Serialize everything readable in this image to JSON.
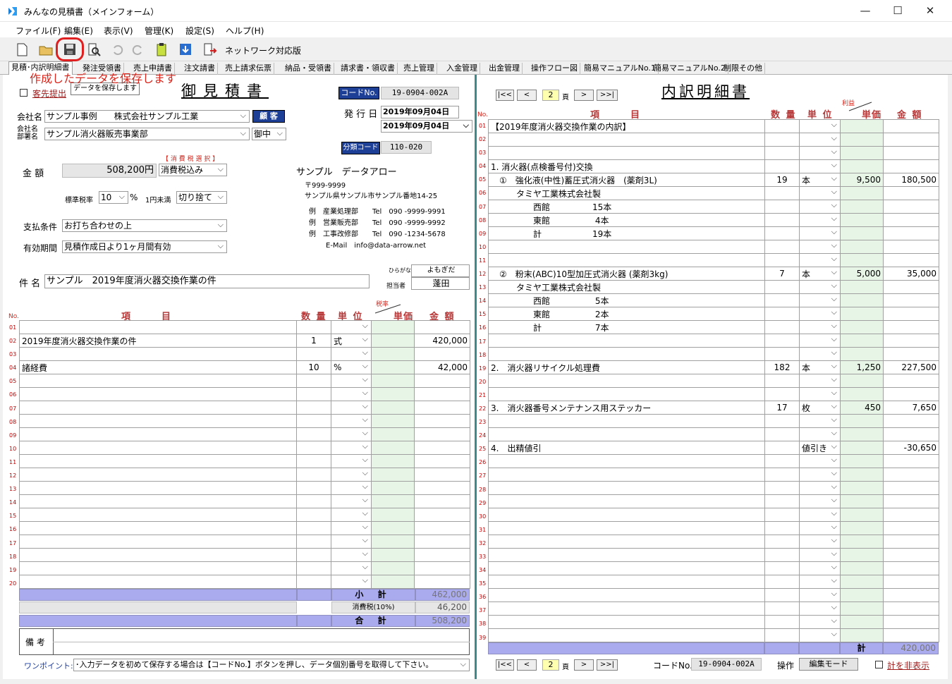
{
  "window": {
    "title": "みんなの見積書（メインフォーム）",
    "minimize": "—",
    "maximize": "☐",
    "close": "✕"
  },
  "menu": [
    "ファイル(F)",
    "編集(E)",
    "表示(V)",
    "管理(K)",
    "設定(S)",
    "ヘルプ(H)"
  ],
  "toolbar": {
    "network_label": "ネットワーク対応版",
    "save_tooltip": "データを保存します",
    "annotation": "作成したデータを保存します"
  },
  "tabs": [
    "見積･内訳明細書",
    "発注受領書",
    "売上申請書",
    "注文請書",
    "売上請求伝票",
    "納品・受領書",
    "請求書・領収書",
    "売上管理",
    "入金管理",
    "出金管理",
    "操作フロー図",
    "簡易マニュアルNo.1",
    "簡易マニュアルNo.2",
    "制限その他"
  ],
  "quote": {
    "title": "御見積書",
    "customer_submit_label": "客先提出",
    "code_label": "コードNo.",
    "code_value": "19-0904-002A",
    "issue_label": "発 行 日",
    "issue_date": "2019年09月04日",
    "issue_date2": "2019年09月04日",
    "class_label": "分類コード",
    "class_value": "110-020",
    "company_label": "会社名",
    "company_value": "サンプル事例　　株式会社サンプル工業",
    "customer_btn": "顧 客",
    "dept_label": "会社名\n部署名",
    "dept_value": "サンプル消火器販売事業部",
    "honorific": "御中",
    "amount_label": "金 額",
    "amount_value": "508,200円",
    "tax_select_label": "【 消 費 税 選 択 】",
    "tax_select_value": "消費税込み",
    "std_tax_label": "標準税率",
    "std_tax_value": "10",
    "percent": "%",
    "round_label": "1円未満",
    "round_value": "切り捨て",
    "payment_label": "支払条件",
    "payment_value": "お打ち合わせの上",
    "validity_label": "有効期間",
    "validity_value": "見積作成日より1ヶ月間有効",
    "subject_label": "件 名",
    "subject_value": "サンプル　2019年度消火器交換作業の件",
    "furigana_label": "ひらがな",
    "furigana_value": "よもぎだ",
    "person_label": "担当者",
    "person_value": "蓬田"
  },
  "sender": {
    "name": "サンプル　データアロー",
    "zip": "〒999-9999",
    "address": "サンプル県サンプル市サンプル番地14-25",
    "lines": [
      "例　産業処理部　　Tel　090 -9999-9991",
      "例　営業販売部　　Tel　090 -9999-9992",
      "例　工事改修部　　Tel　090 -1234-5678"
    ],
    "email": "E-Mail　info@data-arrow.net"
  },
  "left_table": {
    "headers": {
      "no": "No.",
      "item": "項　　目",
      "qty": "数 量",
      "unit": "単 位",
      "tax_rate": "税率",
      "price": "単価",
      "amount": "金 額"
    },
    "rows": [
      {
        "no": "01",
        "item": "",
        "qty": "",
        "unit": "",
        "price": "",
        "amount": ""
      },
      {
        "no": "02",
        "item": "2019年度消火器交換作業の件",
        "qty": "1",
        "unit": "式",
        "price": "",
        "amount": "420,000"
      },
      {
        "no": "03",
        "item": "",
        "qty": "",
        "unit": "",
        "price": "",
        "amount": ""
      },
      {
        "no": "04",
        "item": "諸経費",
        "qty": "10",
        "unit": "%",
        "price": "",
        "amount": "42,000"
      },
      {
        "no": "05",
        "item": "",
        "qty": "",
        "unit": "",
        "price": "",
        "amount": ""
      },
      {
        "no": "06",
        "item": "",
        "qty": "",
        "unit": "",
        "price": "",
        "amount": ""
      },
      {
        "no": "07",
        "item": "",
        "qty": "",
        "unit": "",
        "price": "",
        "amount": ""
      },
      {
        "no": "08",
        "item": "",
        "qty": "",
        "unit": "",
        "price": "",
        "amount": ""
      },
      {
        "no": "09",
        "item": "",
        "qty": "",
        "unit": "",
        "price": "",
        "amount": ""
      },
      {
        "no": "10",
        "item": "",
        "qty": "",
        "unit": "",
        "price": "",
        "amount": ""
      },
      {
        "no": "11",
        "item": "",
        "qty": "",
        "unit": "",
        "price": "",
        "amount": ""
      },
      {
        "no": "12",
        "item": "",
        "qty": "",
        "unit": "",
        "price": "",
        "amount": ""
      },
      {
        "no": "13",
        "item": "",
        "qty": "",
        "unit": "",
        "price": "",
        "amount": ""
      },
      {
        "no": "14",
        "item": "",
        "qty": "",
        "unit": "",
        "price": "",
        "amount": ""
      },
      {
        "no": "15",
        "item": "",
        "qty": "",
        "unit": "",
        "price": "",
        "amount": ""
      },
      {
        "no": "16",
        "item": "",
        "qty": "",
        "unit": "",
        "price": "",
        "amount": ""
      },
      {
        "no": "17",
        "item": "",
        "qty": "",
        "unit": "",
        "price": "",
        "amount": ""
      },
      {
        "no": "18",
        "item": "",
        "qty": "",
        "unit": "",
        "price": "",
        "amount": ""
      },
      {
        "no": "19",
        "item": "",
        "qty": "",
        "unit": "",
        "price": "",
        "amount": ""
      },
      {
        "no": "20",
        "item": "",
        "qty": "",
        "unit": "",
        "price": "",
        "amount": ""
      }
    ],
    "subtotal_label": "小 計",
    "subtotal_value": "462,000",
    "tax_label": "消費税(10%)",
    "tax_value": "46,200",
    "total_label": "合 計",
    "total_value": "508,200",
    "remarks_label": "備 考"
  },
  "onepoint": {
    "label": "ワンポイント:",
    "text": "･入力データを初めて保存する場合は【コードNo.】ボタンを押し、データ個別番号を取得して下さい。"
  },
  "detail": {
    "title": "内訳明細書",
    "page": "2",
    "page_suffix": "頁",
    "nav": {
      "first": "|<<",
      "prev": "<",
      "next": ">",
      "last": ">>|"
    },
    "headers": {
      "no": "No.",
      "item": "項　　目",
      "qty": "数 量",
      "unit": "単 位",
      "profit": "利益",
      "price": "単価",
      "amount": "金 額"
    },
    "rows": [
      {
        "no": "01",
        "item": "【2019年度消火器交換作業の内訳】",
        "qty": "",
        "unit": "",
        "price": "",
        "amount": ""
      },
      {
        "no": "02",
        "item": "",
        "qty": "",
        "unit": "",
        "price": "",
        "amount": ""
      },
      {
        "no": "03",
        "item": "",
        "qty": "",
        "unit": "",
        "price": "",
        "amount": ""
      },
      {
        "no": "04",
        "item": "1. 消火器(点検番号付)交換",
        "qty": "",
        "unit": "",
        "price": "",
        "amount": ""
      },
      {
        "no": "05",
        "item": "　①　強化液(中性)蓄圧式消火器　(薬剤3L)",
        "qty": "19",
        "unit": "本",
        "price": "9,500",
        "amount": "180,500"
      },
      {
        "no": "06",
        "item": "　　　タミヤ工業株式会社製",
        "qty": "",
        "unit": "",
        "price": "",
        "amount": ""
      },
      {
        "no": "07",
        "item": "　　　　　西館　　　　　15本",
        "qty": "",
        "unit": "",
        "price": "",
        "amount": ""
      },
      {
        "no": "08",
        "item": "　　　　　東館　　　　　 4本",
        "qty": "",
        "unit": "",
        "price": "",
        "amount": ""
      },
      {
        "no": "09",
        "item": "　　　　　計　　　　　　19本",
        "qty": "",
        "unit": "",
        "price": "",
        "amount": ""
      },
      {
        "no": "10",
        "item": "",
        "qty": "",
        "unit": "",
        "price": "",
        "amount": ""
      },
      {
        "no": "11",
        "item": "",
        "qty": "",
        "unit": "",
        "price": "",
        "amount": ""
      },
      {
        "no": "12",
        "item": "　②　粉末(ABC)10型加圧式消火器 (薬剤3kg)",
        "qty": "7",
        "unit": "本",
        "price": "5,000",
        "amount": "35,000"
      },
      {
        "no": "13",
        "item": "　　　タミヤ工業株式会社製",
        "qty": "",
        "unit": "",
        "price": "",
        "amount": ""
      },
      {
        "no": "14",
        "item": "　　　　　西館　　　　　 5本",
        "qty": "",
        "unit": "",
        "price": "",
        "amount": ""
      },
      {
        "no": "15",
        "item": "　　　　　東館　　　　　 2本",
        "qty": "",
        "unit": "",
        "price": "",
        "amount": ""
      },
      {
        "no": "16",
        "item": "　　　　　計　　　　　　 7本",
        "qty": "",
        "unit": "",
        "price": "",
        "amount": ""
      },
      {
        "no": "17",
        "item": "",
        "qty": "",
        "unit": "",
        "price": "",
        "amount": ""
      },
      {
        "no": "18",
        "item": "",
        "qty": "",
        "unit": "",
        "price": "",
        "amount": ""
      },
      {
        "no": "19",
        "item": "2.　消火器リサイクル処理費",
        "qty": "182",
        "unit": "本",
        "price": "1,250",
        "amount": "227,500"
      },
      {
        "no": "20",
        "item": "",
        "qty": "",
        "unit": "",
        "price": "",
        "amount": ""
      },
      {
        "no": "21",
        "item": "",
        "qty": "",
        "unit": "",
        "price": "",
        "amount": ""
      },
      {
        "no": "22",
        "item": "3.　消火器番号メンテナンス用ステッカー",
        "qty": "17",
        "unit": "枚",
        "price": "450",
        "amount": "7,650"
      },
      {
        "no": "23",
        "item": "",
        "qty": "",
        "unit": "",
        "price": "",
        "amount": ""
      },
      {
        "no": "24",
        "item": "",
        "qty": "",
        "unit": "",
        "price": "",
        "amount": ""
      },
      {
        "no": "25",
        "item": "4.　出精値引",
        "qty": "",
        "unit": "値引き",
        "price": "",
        "amount": "-30,650"
      },
      {
        "no": "26",
        "item": "",
        "qty": "",
        "unit": "",
        "price": "",
        "amount": ""
      },
      {
        "no": "27",
        "item": "",
        "qty": "",
        "unit": "",
        "price": "",
        "amount": ""
      },
      {
        "no": "28",
        "item": "",
        "qty": "",
        "unit": "",
        "price": "",
        "amount": ""
      },
      {
        "no": "29",
        "item": "",
        "qty": "",
        "unit": "",
        "price": "",
        "amount": ""
      },
      {
        "no": "30",
        "item": "",
        "qty": "",
        "unit": "",
        "price": "",
        "amount": ""
      },
      {
        "no": "31",
        "item": "",
        "qty": "",
        "unit": "",
        "price": "",
        "amount": ""
      },
      {
        "no": "32",
        "item": "",
        "qty": "",
        "unit": "",
        "price": "",
        "amount": ""
      },
      {
        "no": "33",
        "item": "",
        "qty": "",
        "unit": "",
        "price": "",
        "amount": ""
      },
      {
        "no": "34",
        "item": "",
        "qty": "",
        "unit": "",
        "price": "",
        "amount": ""
      },
      {
        "no": "35",
        "item": "",
        "qty": "",
        "unit": "",
        "price": "",
        "amount": ""
      },
      {
        "no": "36",
        "item": "",
        "qty": "",
        "unit": "",
        "price": "",
        "amount": ""
      },
      {
        "no": "37",
        "item": "",
        "qty": "",
        "unit": "",
        "price": "",
        "amount": ""
      },
      {
        "no": "38",
        "item": "",
        "qty": "",
        "unit": "",
        "price": "",
        "amount": ""
      },
      {
        "no": "39",
        "item": "",
        "qty": "",
        "unit": "",
        "price": "",
        "amount": ""
      }
    ],
    "total_label": "計",
    "total_value": "420,000",
    "code_label": "コードNo.",
    "code_value": "19-0904-002A",
    "mode_label": "操作",
    "mode_value": "編集モード",
    "hide_total_label": "計を非表示"
  }
}
